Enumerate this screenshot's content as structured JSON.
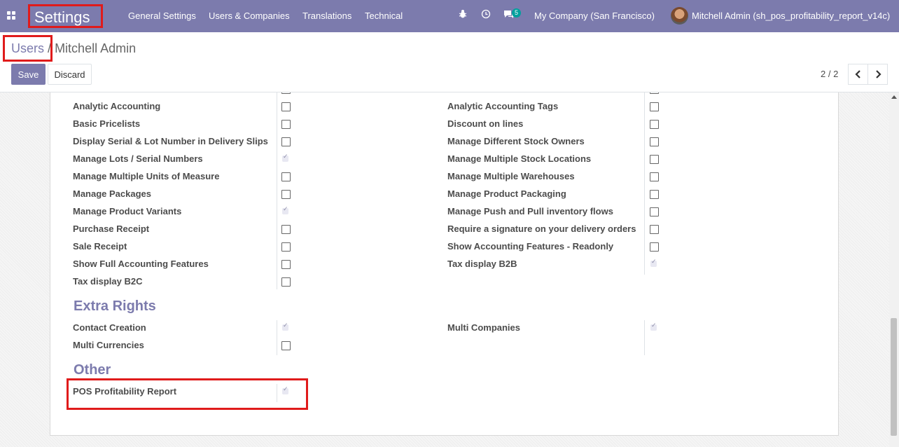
{
  "navbar": {
    "app_title": "Settings",
    "menu": [
      "General Settings",
      "Users & Companies",
      "Translations",
      "Technical"
    ],
    "chat_count": "5",
    "company": "My Company (San Francisco)",
    "user": "Mitchell Admin (sh_pos_profitability_report_v14c)"
  },
  "breadcrumb": {
    "parent": "Users",
    "separator": "/",
    "current": "Mitchell Admin"
  },
  "toolbar": {
    "save_label": "Save",
    "discard_label": "Discard",
    "pager": "2 / 2"
  },
  "rights_left": [
    {
      "label": "Analytic Accounting",
      "checked": false
    },
    {
      "label": "Basic Pricelists",
      "checked": false
    },
    {
      "label": "Display Serial & Lot Number in Delivery Slips",
      "checked": false
    },
    {
      "label": "Manage Lots / Serial Numbers",
      "checked": true
    },
    {
      "label": "Manage Multiple Units of Measure",
      "checked": false
    },
    {
      "label": "Manage Packages",
      "checked": false
    },
    {
      "label": "Manage Product Variants",
      "checked": true
    },
    {
      "label": "Purchase Receipt",
      "checked": false
    },
    {
      "label": "Sale Receipt",
      "checked": false
    },
    {
      "label": "Show Full Accounting Features",
      "checked": false
    },
    {
      "label": "Tax display B2C",
      "checked": false
    }
  ],
  "rights_right": [
    {
      "label": "Analytic Accounting Tags",
      "checked": false
    },
    {
      "label": "Discount on lines",
      "checked": false
    },
    {
      "label": "Manage Different Stock Owners",
      "checked": false
    },
    {
      "label": "Manage Multiple Stock Locations",
      "checked": false
    },
    {
      "label": "Manage Multiple Warehouses",
      "checked": false
    },
    {
      "label": "Manage Product Packaging",
      "checked": false
    },
    {
      "label": "Manage Push and Pull inventory flows",
      "checked": false
    },
    {
      "label": "Require a signature on your delivery orders",
      "checked": false
    },
    {
      "label": "Show Accounting Features - Readonly",
      "checked": false
    },
    {
      "label": "Tax display B2B",
      "checked": true
    }
  ],
  "extra_rights": {
    "title": "Extra Rights",
    "left": [
      {
        "label": "Contact Creation",
        "checked": true
      },
      {
        "label": "Multi Currencies",
        "checked": false
      }
    ],
    "right": [
      {
        "label": "Multi Companies",
        "checked": true
      }
    ]
  },
  "other": {
    "title": "Other",
    "items": [
      {
        "label": "POS Profitability Report",
        "checked": true
      }
    ]
  },
  "colors": {
    "brand": "#7c7bad",
    "highlight": "#e01b1b",
    "badge": "#00a09d"
  }
}
